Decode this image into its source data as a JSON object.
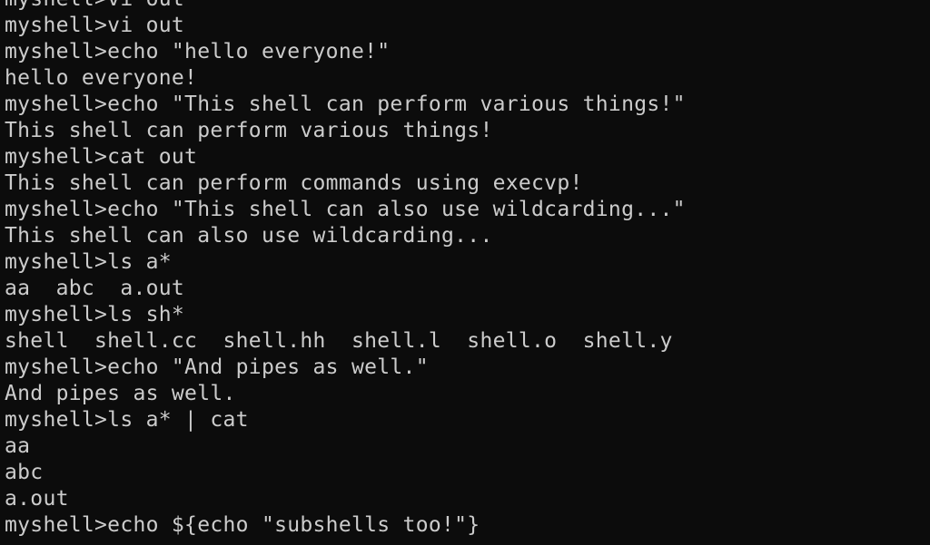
{
  "terminal": {
    "lines": [
      "myshell>vi out",
      "myshell>vi out",
      "myshell>echo \"hello everyone!\"",
      "hello everyone!",
      "myshell>echo \"This shell can perform various things!\"",
      "This shell can perform various things!",
      "myshell>cat out",
      "This shell can perform commands using execvp!",
      "myshell>echo \"This shell can also use wildcarding...\"",
      "This shell can also use wildcarding...",
      "myshell>ls a*",
      "aa  abc  a.out",
      "myshell>ls sh*",
      "shell  shell.cc  shell.hh  shell.l  shell.o  shell.y",
      "myshell>echo \"And pipes as well.\"",
      "And pipes as well.",
      "myshell>ls a* | cat",
      "aa",
      "abc",
      "a.out",
      "myshell>echo ${echo \"subshells too!\"}"
    ]
  }
}
